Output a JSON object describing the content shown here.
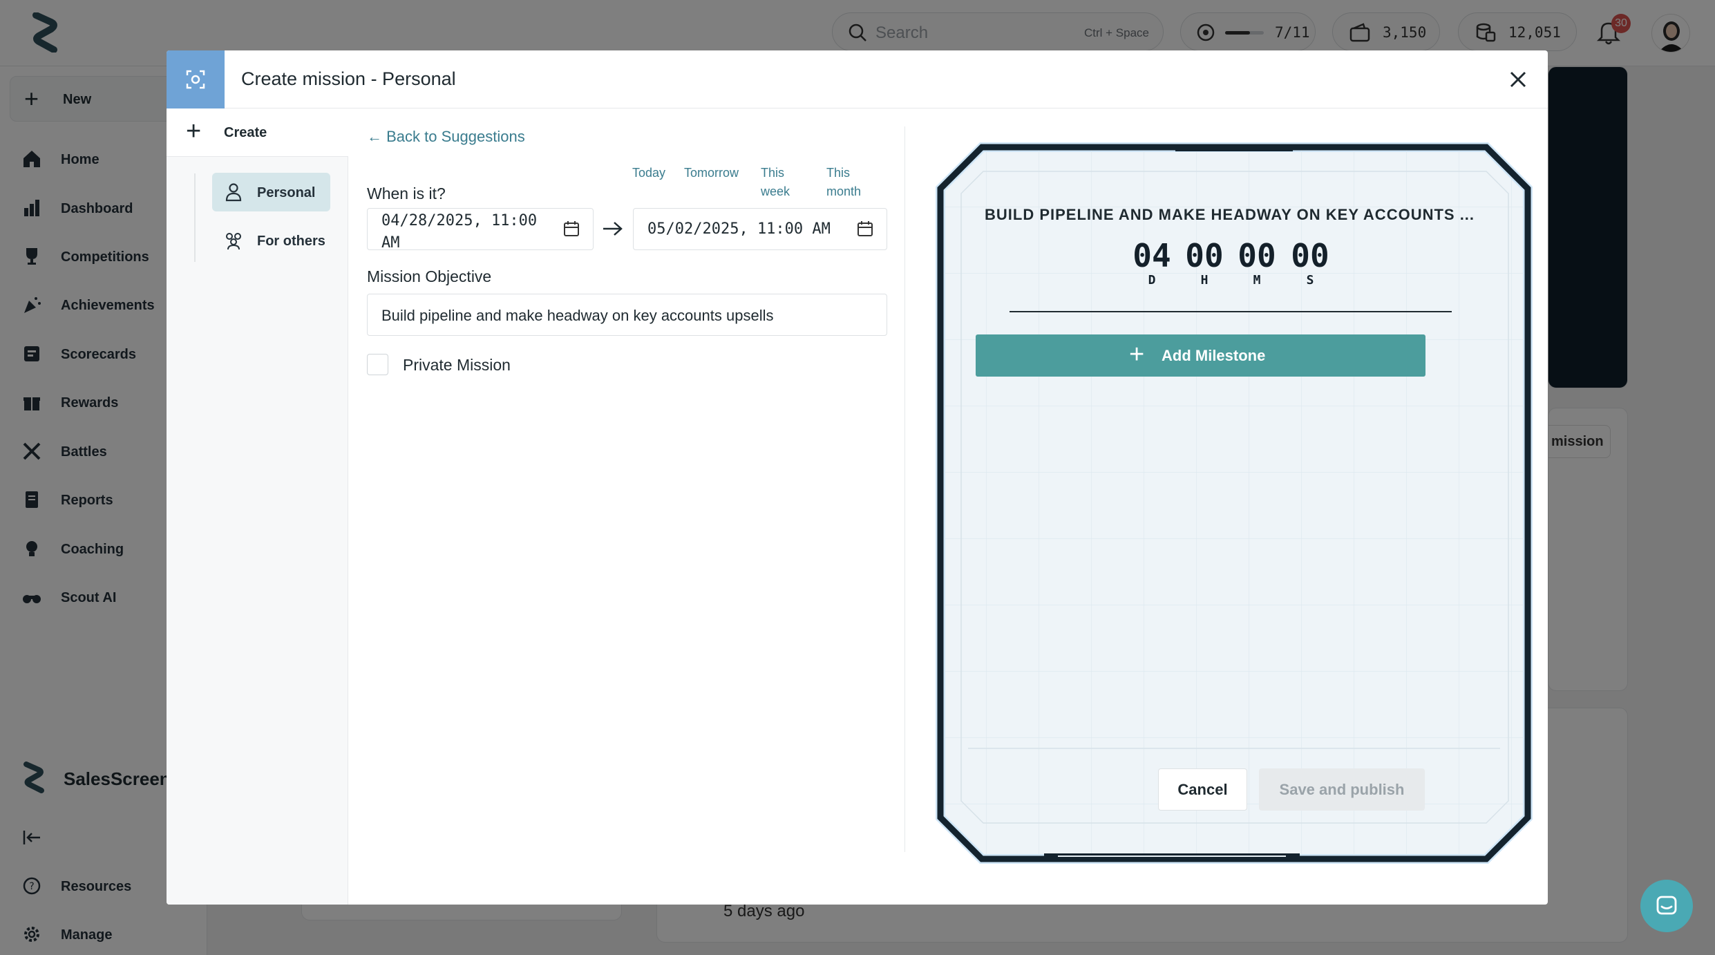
{
  "topbar": {
    "search_placeholder": "Search",
    "search_shortcut": "Ctrl + Space",
    "level_progress": "7/11",
    "level_fraction": 0.64,
    "coins": "3,150",
    "points": "12,051",
    "notifications_count": "30"
  },
  "sidebar": {
    "new_label": "New",
    "items": [
      {
        "label": "Home",
        "icon": "home-icon"
      },
      {
        "label": "Dashboard",
        "icon": "bar-chart-icon"
      },
      {
        "label": "Competitions",
        "icon": "trophy-icon"
      },
      {
        "label": "Achievements",
        "icon": "party-popper-icon"
      },
      {
        "label": "Scorecards",
        "icon": "scorecard-icon"
      },
      {
        "label": "Rewards",
        "icon": "gift-icon"
      },
      {
        "label": "Battles",
        "icon": "crossed-swords-icon"
      },
      {
        "label": "Reports",
        "icon": "report-icon"
      },
      {
        "label": "Coaching",
        "icon": "lightbulb-icon"
      },
      {
        "label": "Scout AI",
        "icon": "binoculars-icon"
      }
    ],
    "brand": "SalesScreen",
    "bottom_items": [
      {
        "label": "Resources",
        "icon": "help-circle-icon"
      },
      {
        "label": "Manage",
        "icon": "gear-icon"
      }
    ]
  },
  "background": {
    "mission_button_fragment": "mission",
    "activity_time": "5 days ago"
  },
  "modal": {
    "title": "Create mission - Personal",
    "left": {
      "create_label": "Create",
      "options": [
        {
          "label": "Personal",
          "active": true
        },
        {
          "label": "For others",
          "active": false
        }
      ]
    },
    "form": {
      "back_label": "Back to Suggestions",
      "when_label": "When is it?",
      "quick_dates": {
        "today": "Today",
        "tomorrow": "Tomorrow",
        "this_week_1": "This",
        "this_week_2": "week",
        "this_month_1": "This",
        "this_month_2": "month"
      },
      "start_line1": "04/28/2025, 11:00",
      "start_line2": "AM",
      "end": "05/02/2025, 11:00 AM",
      "objective_label": "Mission Objective",
      "objective_value": "Build pipeline and make headway on key accounts upsells",
      "private_label": "Private Mission",
      "private_checked": false
    },
    "preview": {
      "title": "BUILD PIPELINE AND MAKE HEADWAY ON KEY ACCOUNTS ...",
      "countdown": [
        {
          "value": "04",
          "unit": "D"
        },
        {
          "value": "00",
          "unit": "H"
        },
        {
          "value": "00",
          "unit": "M"
        },
        {
          "value": "00",
          "unit": "S"
        }
      ],
      "add_milestone_label": "Add Milestone",
      "cancel_label": "Cancel",
      "save_label": "Save and publish"
    }
  },
  "colors": {
    "teal": "#4c9d9d",
    "link": "#3a7c8e",
    "header_accent": "#6fa3d6",
    "active_option": "#d5e6ea"
  }
}
